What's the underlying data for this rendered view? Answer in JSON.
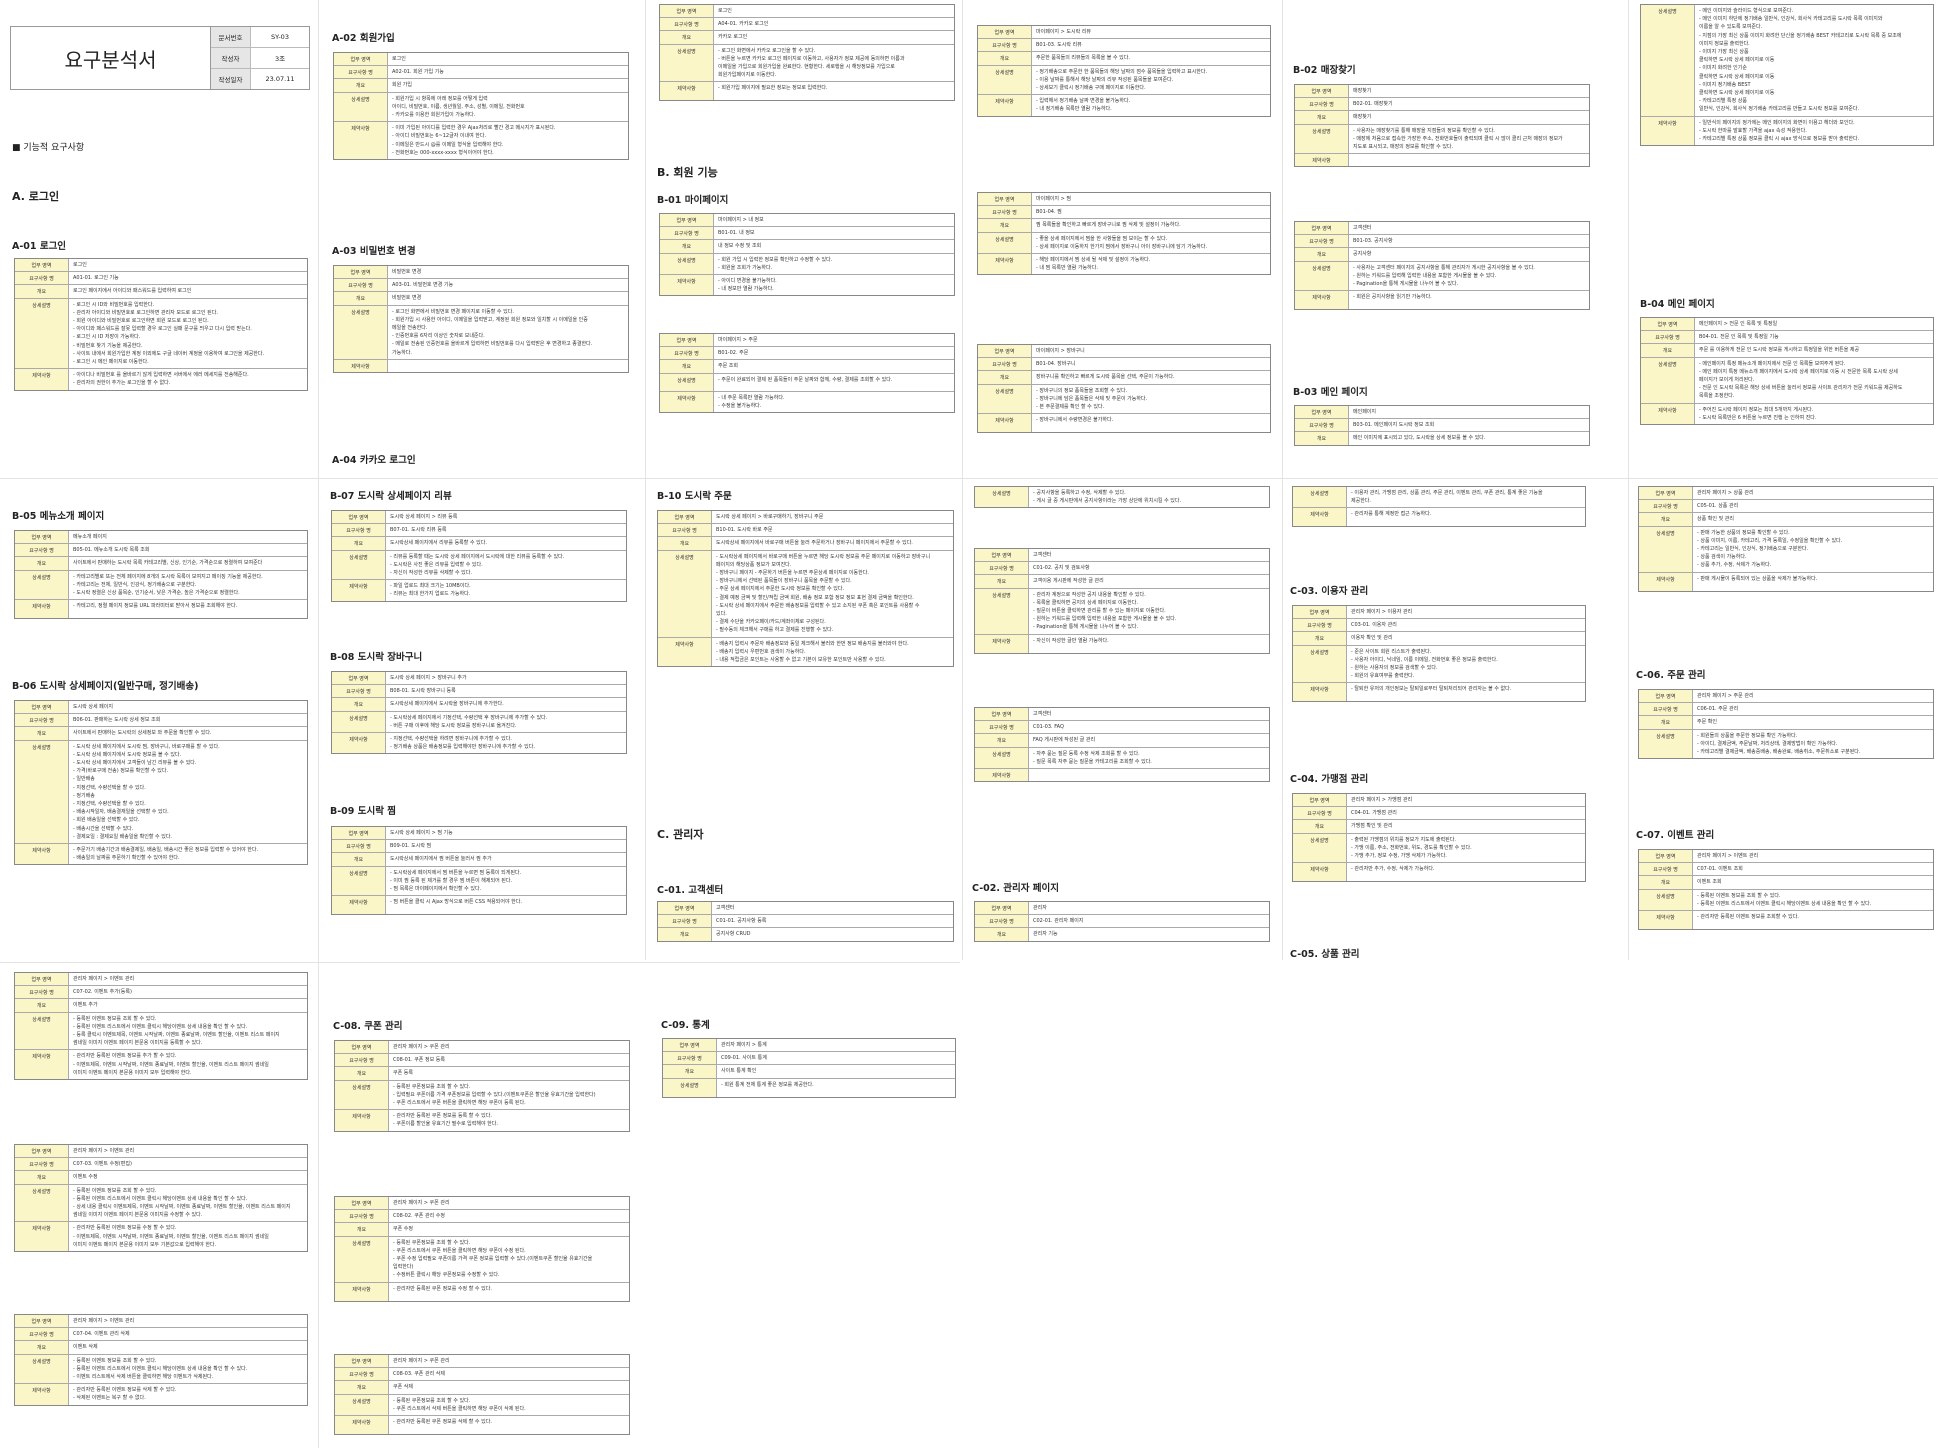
{
  "doc": {
    "title": "요구분석서",
    "meta": [
      {
        "k": "문서번호",
        "v": "SY-03"
      },
      {
        "k": "작성자",
        "v": "3조"
      },
      {
        "k": "작성일자",
        "v": "23.07.11"
      }
    ],
    "section_heading": "■ 기능적 요구사항"
  },
  "labels": {
    "area": "업무 영역",
    "req": "요구사항 명",
    "overview": "개요",
    "detail": "상세설명",
    "constraint": "제약사항"
  },
  "headings": {
    "a": "A. 로그인",
    "a01": "A-01 로그인",
    "a02": "A-02 회원가입",
    "a03": "A-03 비밀번호 변경",
    "a04": "A-04 카카오 로그인",
    "b": "B. 회원 기능",
    "b01": "B-01 마이페이지",
    "b02": "B-02 매장찾기",
    "b03": "B-03 메인 페이지",
    "b04": "B-04 메인 페이지",
    "b05": "B-05 메뉴소개 페이지",
    "b06": "B-06 도시락 상세페이지(일반구매, 정기배송)",
    "b07": "B-07 도시락 상세페이지 리뷰",
    "b08": "B-08 도시락 장바구니",
    "b09": "B-09 도시락 찜",
    "b10": "B-10 도시락 주문",
    "c": "C. 관리자",
    "c01": "C-01. 고객센터",
    "c02": "C-02. 관리자 페이지",
    "c03": "C-03. 이용자 관리",
    "c04": "C-04. 가맹점 관리",
    "c05": "C-05. 상품 관리",
    "c06": "C-06. 주문 관리",
    "c07": "C-07. 이벤트 관리",
    "c08": "C-08. 쿠폰 관리",
    "c09": "C-09. 통계"
  },
  "tables": {
    "a01": {
      "area": "로그인",
      "req": "A01-01. 로그인 기능",
      "overview": "로그인 페이지에서 아이디와 패스워드를 입력하여 로그인",
      "detail": [
        "- 로그인 시 ID와 비밀번호를 입력한다.",
        "- 관리자 아이디와 비밀번호로 로그인하면 관리자 모드로 로그인 된다.",
        "- 회원 아이디와 비밀번호로 로그인하면 회원 모드로 로그인 된다.",
        "- 아이디와 패스워드를 잘못 입력할 경우 로그인 실패 문구를 띄우고 다시 입력 받는다.",
        "- 로그인 시 ID 저장이 가능하다.",
        "- 비밀번호 찾기 기능을 제공한다.",
        "- 사이트 내에서 회원가입한 계정 이외에도 구글 네이버 계정을 이용하여 로그인을 제공한다.",
        "- 로그인 시 메인 페이지로 이동한다."
      ],
      "constraint": [
        "- 아이디나 비밀번호 를 올바르기 않게 입력하면 서버에서 에러 메세지를 전송해준다.",
        "- 관리자의 권한이 추가는 로그인을 할 수 없다."
      ]
    },
    "a02": {
      "area": "로그인",
      "req": "A02-01. 회원 가입 기능",
      "overview": "회원 가입",
      "detail": [
        "- 회원가입 시 항목에 아래 정보를 어떻게 입력",
        "  아이디, 비밀번호, 이름, 생년월일, 주소, 성별, 이메일, 전화번호",
        "- 카카오를 이용한 회원가입이 가능하다."
      ],
      "constraint": [
        "- 이미 가입된 아이디를 입력한 경우 Ajax처리로 빨간 경고 메시지가 표시된다.",
        "- 아이디 비밀번호는 6~12글자 이내여 한다.",
        "- 이메일은 반드시 @를 이메일 형식을 입력해야 한다.",
        "- 전화번호는 000-xxxx-xxxx 형식이어야 한다."
      ]
    },
    "a03": {
      "area": "비밀번호 변경",
      "req": "A03-01. 비밀번호 변경 기능",
      "overview": "비밀번호 변경",
      "detail": [
        "- 로그인 화면에서 비밀번호 변경 페이지로 이동할 수 있다.",
        "- 회원가입 시 사용한 아이디, 이메일을 입력받고, 계정된 회원 정보와 일치할 시 이메일을 인증",
        "  메일을 전송한다.",
        "- 인증번호를 6자리 이상인 숫자로 보내준다.",
        "- 메일로 전송된 인증번호를 올바르게 입력하면 비밀번호를 다시 입력받은 후 변경하고 종결한다.",
        "  가능하다."
      ],
      "constraint": []
    },
    "a04": {
      "area": "로그인",
      "req": "A04-01. 카카오 로그인",
      "overview": "카카오 로그인",
      "detail": [
        "- 로그인 화면에서 카카오 로그인을 할 수 있다.",
        "- 버튼을 누르면 카카오 로그인 페이지로 이동하고, 사용자가 정보 제공에 동의하면 이름과",
        "  이메일을 가입으로 회원가입을 완료한다. 현황한다. 세로행을 시 해당정보를 가입으로",
        "  회원가입페이지로 이동한다."
      ],
      "constraint": [
        "- 회원가입 페이지에 필요한 정보는 정보로 입력한다."
      ]
    },
    "b01a": {
      "area": "마이페이지 > 내 정보",
      "req": "B01-01. 내 정보",
      "overview": "내 정보 수정 및 조회",
      "detail": [
        "- 회원 가입 시 입력한 정보를 확인하고 수정할 수 있다.",
        "- 회원을 조회가 가능하다."
      ],
      "constraint": [
        "- 아이디 변경을 불가능하다.",
        "- 내 정보만 열람 가능하다."
      ]
    },
    "b01b": {
      "area": "마이페이지 > 주문",
      "req": "B01-02. 주문",
      "overview": "주문 조회",
      "detail": [
        "- 주문이 완료되어 결제 된 품목들이 주문 날짜와 함께, 수량, 결제를 조회할 수 있다."
      ],
      "constraint": [
        "- 내 주문 목록만 열람 가능하다.",
        "- 수정을 불가능하다."
      ]
    },
    "b01c": {
      "area": "마이페이지 > 도시락 리뷰",
      "req": "B01-03. 도시락 리뷰",
      "overview": "주문한 품목들의 리뷰들의 목록을 볼 수 있다.",
      "detail": [
        "- 정기배송으로 주문한 한 품목들의 해당 날짜의 점수 품목들을 입력하고 표시한다.",
        "- 이용 날짜를 통해서 해당 날짜의 리뷰 작성된 품목들을 보여준다.",
        "- 상세보기 클릭시 정기배송 구매 페이지로 이동한다."
      ],
      "constraint": [
        "- 입력해서 정기배송 날짜 변경을 불가능하다.",
        "- 내 정기배송 목록만 열람 가능하다."
      ]
    },
    "b01d": {
      "area": "마이페이지 > 찜",
      "req": "B01-04. 찜",
      "overview": "찜 목록들을 확인하고 빠르게 장바구니로 찜 삭제 및 설정이 가능하다.",
      "detail": [
        "- 좋을 상세 페이지에서 찜을 한 사항들을 찜 보이는 할 수 있다.",
        "- 상세 페이지로 이동하지 한가지 찜에서 장바구니 아이 장바구니에 담기 가능하다."
      ],
      "constraint": [
        "- 해당 페이지에서 찜 상세 될 삭제 및 설정이 가능하다.",
        "- 내 찜 목록만 열람 가능하다."
      ]
    },
    "b01e": {
      "area": "마이페이지 > 장바구니",
      "req": "B01-04. 장바구니",
      "overview": "장바구니를 확인하고 빠르게 도시락 품목을 선택, 주문이 가능하다.",
      "detail": [
        "- 장바구니의 정보 품목들을 조회할 수 있다.",
        "- 장바구니에 담은 품목들은 삭제 및 주문이 가능하다.",
        "- 본 주문결제를 확인 할 수 있다."
      ],
      "constraint": [
        "- 장바구니에서 수량변경은 불가하다."
      ]
    },
    "b02a": {
      "area": "매장찾기",
      "req": "B02-01. 매장찾기",
      "overview": "매장찾기",
      "detail": [
        "- 사용자는 매장찾기를 통해 매장을 지점들의 정보를 확인할 수 있다.",
        "- 매장에 처음으로 접속한 가장한 주소, 전화번호들이 출력되며 클릭 시 많이 클리 근처 매장의 정보가",
        "  지도로 표시되고, 매장의 정보를 확인할 수 있다."
      ],
      "constraint": []
    },
    "b02b": {
      "area": "고객센터",
      "req": "B01-03. 공지사항",
      "overview": "공지사항",
      "detail": [
        "- 사용자는 고객센터 페이지의 공지사항을 통해 관리자가 게시한 공지사항을 볼 수 있다.",
        "- 원하는 키워드를 입력해 입력한 내용을 포함한 게시물을 볼 수 있다.",
        "- Pagination을 통해 게시물을 나누어 볼 수 있다."
      ],
      "constraint": [
        "- 회원은 공지사항을 읽기만 가능하다."
      ]
    },
    "b03": {
      "area": "메인페이지",
      "req": "B03-01. 메인페이지 도시락 정보 조회",
      "overview": "메인 이미지에 표시되고 있다, 도시락을 상세 정보를 볼 수 있다."
    },
    "b04": {
      "area": "메인페이지 > 전문 인 목록 및 특정일",
      "req": "B04-01. 전문 인 목록 및 특정일 기능",
      "overview": "주문 를 이용하게 전문 인 도시락 정보를 게시하고 특정일을 위한 버튼을 제공",
      "detail": [
        "- 메인페이지 특정 메뉴소개 페이지에서 전문 인 목록들 보여주게 된다.",
        "- 메인 페이지 특정 메뉴소개 페이지에서 도시락 상세 페이지로 이동 시 전문한 목록 도시락 상세",
        "  페이지가 보이게 처리된다.",
        "- 전문 인 도시락 목록은 해당 상세 버튼을 눌러서 정보를 사이트 관리자가 전문 키워드를 제공하도",
        "  목록을 조정한다."
      ],
      "constraint": [
        "- 주어진 도시락 페이지 정보는 최대 5개까지 게시된다.",
        "- 도시락 목록만은 6 버튼을 누르면 진행 는 인하여 진다."
      ]
    },
    "b04top": {
      "detail": [
        "- 메인 이미지와 슬라이드 형식으로 보여준다.",
        "- 메인 이미지 하단에 정기배송 일반식, 인강식, 회사식 카테고리를 도시락 목록 이미지와",
        "  이름을 알 수 있도록 보여준다.",
        "- 지점의 가장 최신 상품 이미지 화려한 단신을 정기배송 BEST 카테고리로 도시락 목록 중 보조에",
        "  이미지 정보를 출력한다.",
        "- 이미지 가장 최신 상품",
        "  클릭하면 도시락 상세 페이지로 이동",
        "- 이미지 화려한 인기순",
        "  클릭하면 도시락 상세 페이지로 이동",
        "- 이미지 정기배송 BEST",
        "  클릭하면 도시락 상세 페이지로 이동",
        "- 카테고리별 특정 상품",
        "  일반식, 인강식, 회사식 정기배송 카테고리를 만들고 도시락 정보를 보여준다."
      ],
      "constraint": [
        "- 일반식의 페이지의 정가에는 메인 페이지의 화면이 이용고 헤더와 보인다.",
        "- 도시락 한마를 발효할 가격을 ajax 속성 적용한다.",
        "- 카테고리별 특정 상품 정보를 클릭 시 ajax 방식으로 정보를 받아 출력한다."
      ]
    },
    "b05": {
      "area": "메뉴소개 페이지",
      "req": "B05-01. 메뉴소개 도시락 목록 조회",
      "overview": "사이트에서 판매하는 도시락 목록 카테고리별, 신상, 인기순, 가격순으로 정렬하여 보여준다",
      "detail": [
        "- 카테고리별로 또는 전체 페이지에 8개의 도시락 목록이 보여지고 페이징 기능을 제공한다.",
        "- 카테고리는 전체, 일반식, 인강식, 정기배송으로 구분한다.",
        "- 도시락 정렬은 신상 품목순, 인기순서, 낮은 가격순, 높은 가격순으로 정렬한다."
      ],
      "constraint": [
        "- 카테고리, 정렬 페이지 정보를 URL 파라미터로 받아서 정보를 조회해야 한다."
      ]
    },
    "b06": {
      "area": "도시락 상세 페이지",
      "req": "B06-01. 판매하는 도시락 상세 정보 조회",
      "overview": "사이트에서 판매하는 도시락의 상세정보 와 주문을 확인할 수 있다.",
      "detail": [
        "- 도시락 상세 페이지에서 도시락 찜, 장바구니, 바로구매를 할 수 있다.",
        "- 도시락 상세 페이지에서 도시락 정보를 볼 수 있다.",
        "- 도시락 상세 페이지에서 고객들이 남긴 리뷰를 볼 수 있다.",
        "- 가격(바로구매 전송) 정보를 확인할 수 있다.",
        "- 일반배송",
        "  - 지정선택, 수량선택을 할 수 있다.",
        "- 정기배송",
        "  - 지정선택, 수량선택을 할 수 있다.",
        "  - 배송시작일자, 배송결재일을 선택할 수 있다.",
        "  - 회원 배송일을 선택할 수 있다.",
        "  - 배송시간을 선택할 수 있다.",
        "  - 결제요일 : 결제요일 배송일을 확인할 수 있다."
      ],
      "constraint": [
        "- 주문가기 배송기간과 배송결제일, 배송일, 배송시간 좋은 정보를 입력할 수 있어야 한다.",
        "- 배송일의 날짜를 주문하기 확인할 수 있어야 한다."
      ]
    },
    "b07": {
      "area": "도시락 상세 페이지 > 리뷰 등록",
      "req": "B07-01. 도시락 리뷰 등록",
      "overview": "도시락상세 페이지에서 리뷰를 등록할 수 있다.",
      "detail": [
        "- 리뷰를 등록할 때는 도시락 상세 페이지에서 도시락에 대한 리뷰를 등록할 수 있다.",
        "- 도시락은 사진 좋은 리뷰를 입력할 수 있다.",
        "- 자신이 작성한 리뷰를 삭제할 수 있다."
      ],
      "constraint": [
        "- 파일 업로드 최대 크기는 10MB이다.",
        "- 리뷰는 최대 한가지 업로드 가능하다."
      ]
    },
    "b08": {
      "area": "도시락 상세 페이지 > 장바구니 추가",
      "req": "B08-01. 도시락 장바구니 등록",
      "overview": "도시락상세 페이지에서 도시락을 장바구니에 추가한다.",
      "detail": [
        "- 도시락상세 페이지에서 기정선택, 수량선택 후 장바구니에 추가할 수 있다.",
        "- 버튼 구매 이후에 해당 도시락 정보를 장바구니로 옮겨진다."
      ],
      "constraint": [
        "- 지정선택, 수량선택을 하려면 장바구니에 추가할 수 있다.",
        "- 정기배송 상품은 배송정보를 입력해야만 장바구니에 추가할 수 있다."
      ]
    },
    "b09": {
      "area": "도시락 상세 페이지 > 찜 기능",
      "req": "B09-01. 도시락 찜",
      "overview": "도시락상세 페이지에서 찜 버튼을 눌러서 찜 추가",
      "detail": [
        "- 도시락상세 페이지에서 찜 버튼을 누르면 찜 등록이 되게된다.",
        "- 이미 찜 등록 된 제거를 할 경우 찜 버튼이 해제되어 된다.",
        "- 찜 목록은 마이페이지에서 확인할 수 있다."
      ],
      "constraint": [
        "- 찜 버튼을 클릭 시 Ajax 방식으로 버튼 CSS 적용되어야 한다."
      ]
    },
    "b10": {
      "area": "도시락 상세 페이지 > 바로구매하기, 장바구니 주문",
      "req": "B10-01. 도시락 바로 주문",
      "overview": "도시락상세 페이지에서 바로구매 버튼을 눌러 주문하거나 장바구니 페이지에서 주문할 수 있다.",
      "detail": [
        "- 도시락상세 페이지에서 바로구매 버튼을 누르면 해당 도시락 정보를 주문 페이지로 이동하고 장바구니",
        "  페이지의 해당상품 정보가 보여진다.",
        "- 장바구니 페이지 - 주문하기 버튼을 누르면 주문상세 페이지로 이동한다.",
        "- 장바구니에서 선택된 품목들이 장바구니 품목을 주문할 수 있다.",
        "- 주문 상세 페이지에서 주문한 도시락 정보를 확인할 수 있다.",
        "- 결제 예정 금액 및 할인/적립 금액 회원, 배송 정보 포함 정보 정보 표현 결제 금액을 확인한다.",
        "- 도시락 상세 페이지에서 주문한 배송정보를 입력할 수 있고 소지된 쿠폰 혹은 포인트를 사용할 수",
        "  있다.",
        "- 결제 수단을 카카오페이/카드/계좌이체로 구성된다.",
        "- 필수동의 체크해서 구매를 하고 결제를 진행할 수 있다."
      ],
      "constraint": [
        "- 배송지 입력시 주문자 배송정보와 동일 체크해서 불러와 한번 정보 배송지를 불러와야 한다.",
        "- 배송지 입력시 우편번호 검색이 가능하다.",
        "- 내용 적립금은 포인트는 사용할 수 없고 기본이 보유한 포인트만 사용할 수 있다."
      ]
    },
    "b10more": {
      "detail": [
        "- 공지사항을 등록하고 수정, 삭제할 수 있다.",
        "- 게시 글 중 게시판에서 공지사항이라는 가장 상단에 위치시킬 수 있다."
      ]
    },
    "c01x": {
      "area": "고객센터",
      "req": "C01-02. 공지 및 검토사항",
      "overview": "고객이용 게시판에 작성한 글 관리",
      "detail": [
        "- 관리자 계정으로 작성한 공지 내용을 확인할 수 있다.",
        "- 목록을 클릭하면 공지의 상세 페이지로 이동한다.",
        "- 질문이 버튼을 클릭하면 관리를 할 수 있는 페이지로 이동한다.",
        "- 원하는 키워드를 입력해 입력한 내용을 포함한 게시물을 볼 수 있다.",
        "- Pagination을 통해 게시물을 나누어 볼 수 있다."
      ],
      "constraint": [
        "- 자신이 작성한 글만 열람 가능하다."
      ]
    },
    "c01y": {
      "area": "고객센터",
      "req": "C01-03. FAQ",
      "overview": "FAQ 게시판에 작성된 글 관리",
      "detail": [
        "- 자주 묻는 질문 등록 수정 삭제 조회를 할 수 있다.",
        "- 질문 목록 자주 묻는 질문을 카테고리를 조회할 수 있다."
      ],
      "constraint": []
    },
    "c01": {
      "area": "고객센터",
      "req": "C01-01. 공지사항 등록",
      "overview": "공지사항 CRUD"
    },
    "c02": {
      "area": "관리자",
      "req": "C02-01. 관리자 페이지",
      "overview": "관리자 기능"
    },
    "c02top": {
      "detail": [
        "- 이용자 관리, 가맹점 관리, 상품 관리, 주문 관리, 이벤트 관리, 쿠폰 관리, 통계 좋은 기능을",
        "  제공한다."
      ],
      "constraint": [
        "- 관리자를 통해 계정만 접근 가능하다."
      ]
    },
    "c03": {
      "area": "관리자 페이지 > 이용자 관리",
      "req": "C03-01. 이용자 관리",
      "overview": "이용자 확인 및 관리",
      "detail": [
        "- 준은 사이트 회원 리스트가 출력된다.",
        "- 사용자 아이디, 닉네임, 이름 이메일, 전화번호 좋은 정보를 출력한다.",
        "- 원하는 사용자의 정보를 검색할 수 있다.",
        "- 회원의 유효여부를 출력한다."
      ],
      "constraint": [
        "- 탈퇴한 유저의 개인정보는 탈퇴일로부터 탈퇴처리되어 관리자는 볼 수 없다."
      ]
    },
    "c04": {
      "area": "관리자 페이지 > 가맹점 관리",
      "req": "C04-01. 가맹점 관리",
      "overview": "가맹점 확인 및 관리",
      "detail": [
        "- 출력된 가맹점의 위치를 정보가 지도에 출력된다.",
        "- 가맹 이름, 주소, 전화번호, 위도, 경도를 확인할 수 있다.",
        "- 가맹 추가, 정보 수정, 가맹 삭제가 가능하다."
      ],
      "constraint": [
        "- 관리자만 추가, 수정, 삭제가 가능하다."
      ]
    },
    "c05": {
      "area": "관리자 페이지 > 상품 관리",
      "req": "C05-01. 상품 관리",
      "overview": "상품 확인 및 관리",
      "detail": [
        "- 판매 가능한 상품의 정보를 확인할 수 있다.",
        "- 상품 이미지, 이름, 카테고리, 가격 등록일, 수정일을 확인할 수 있다.",
        "- 카테고리는 일반식, 인강식, 정기배송으로 구분한다.",
        "- 상품 검색이 가능하다.",
        "- 상품 추가, 수정, 삭제가 가능하다."
      ],
      "constraint": [
        "- 판매 게시물이 등록되어 있는 상품을 삭제가 불가능하다."
      ]
    },
    "c06": {
      "area": "관리자 페이지 > 주문 관리",
      "req": "C06-01. 주문 관리",
      "overview": "주문 확인",
      "detail": [
        "- 회원들의 상품을 주문한 정보를 확인 가능하다.",
        "- 아이디, 결제금액, 주문날짜, 처리상태, 결제방법이 확인 가능하다.",
        "- 카테고리별 결제금액, 배송중배송, 배송완료, 배송취소, 주문취소로 구분된다."
      ],
      "constraint": []
    },
    "c07a": {
      "area": "관리자 페이지 > 이벤트 관리",
      "req": "C07-01. 이벤트 조회",
      "overview": "이벤트 조회",
      "detail": [
        "- 등록된 이벤트 정보를 조회 할 수 있다.",
        "- 등록된 이벤트 리스트에서 이벤트 클릭시 해당이벤트 상세 내용을 확인 할 수 있다."
      ],
      "constraint": [
        "- 관리자만 등록된 이벤트 정보를 조회할 수 있다."
      ]
    },
    "c07b": {
      "area": "관리자 페이지 > 이벤트 관리",
      "req": "C07-02. 이벤트 추가(등록)",
      "overview": "이벤트 추가",
      "detail": [
        "- 등록된 이벤트 정보를 조회 할 수 있다.",
        "- 등록된 이벤트 리스트에서 이벤트 클릭시 해당이벤트 상세 내용을 확인 할 수 있다.",
        "- 등록 클릭시 이벤트제목, 이벤트 시작날짜, 이벤트 종료날짜, 이벤트 할인율, 이벤트 리스트 페이지",
        "  썸네일 이미지 이벤트 페이지 본문용 이미지를 등록할 수 있다."
      ],
      "constraint": [
        "- 관리자만 등록된 이벤트 정보를 추가 할 수 있다.",
        "- 이벤트제목, 이벤트 시작날짜, 이벤트 종료날짜, 이벤트 할인율, 이벤트 리스트 페이지 썸네일",
        "  이미지 이벤트 페이지 본문용 이미지 모두 입력해야 한다."
      ]
    },
    "c07c": {
      "area": "관리자 페이지 > 이벤트 관리",
      "req": "C07-03. 이벤트 수정(편집)",
      "overview": "이벤트 수정",
      "detail": [
        "- 등록된 이벤트 정보를 조회 할 수 있다.",
        "- 등록된 이벤트 리스트에서 이벤트 클릭시 해당이벤트 상세 내용을 확인 할 수 있다.",
        "- 상세 내용 클릭시 이벤트제목, 이벤트 시작날짜, 이벤트 종료날짜, 이벤트 할인율, 이벤트 리스트 페이지",
        "  썸네일 이미지 이벤트 페이지 본문용 이미지를 수정할 수 있다."
      ],
      "constraint": [
        "- 관리자만 등록된 이벤트 정보를 수정 할 수 있다.",
        "- 이벤트제목, 이벤트 시작날짜, 이벤트 종료날짜, 이벤트 할인율, 이벤트 리스트 페이지 썸네일",
        "  이미지 이벤트 페이지 본문용 이미지 모두 기본값으로 입력해야 한다."
      ]
    },
    "c07d": {
      "area": "관리자 페이지 > 이벤트 관리",
      "req": "C07-04. 이벤트 관리 삭제",
      "overview": "이벤트 삭제",
      "detail": [
        "- 등록된 이벤트 정보를 조회 할 수 있다.",
        "- 등록된 이벤트 리스트에서 이벤트 클릭시 해당이벤트 상세 내용을 확인 할 수 있다.",
        "- 이벤트 리스트에서 삭제 버튼을 클릭하면 해당 이벤트가 삭제된다."
      ],
      "constraint": [
        "- 관리자만 등록된 이벤트 정보를 삭제 할 수 있다.",
        "- 삭제된 이벤트는 복구 할 수 없다."
      ]
    },
    "c08a": {
      "area": "관리자 페이지 > 쿠폰 관리",
      "req": "C08-01. 쿠폰 정보 등록",
      "overview": "쿠폰 등록",
      "detail": [
        "- 등록된 쿠폰정보를 조회 할 수 있다.",
        "- 입력필요 쿠폰이름 가격 쿠폰정보를 입력할 수 있다.(이벤트쿠폰은 할인율 유효기간을 입력한다)",
        "- 쿠폰 리스트에서 쿠폰 버튼을 클릭하면 해당 쿠폰이 등록 된다."
      ],
      "constraint": [
        "- 관리자만 등록된 쿠폰 정보를 등록 할 수 있다.",
        "- 쿠폰이름 할인율 유효기간 필수로 입력해야 한다."
      ]
    },
    "c08b": {
      "area": "관리자 페이지 > 쿠폰 관리",
      "req": "C08-02. 쿠폰 관리 수정",
      "overview": "쿠폰 수정",
      "detail": [
        "- 등록된 쿠폰정보를 조회 할 수 있다.",
        "- 쿠폰 리스트에서 쿠폰 버튼을 클릭하면 해당 쿠폰이 수정 된다.",
        "- 쿠폰 수정 입력필요 쿠폰이름 가격 쿠폰 정보를 입력할 수 있다.(이벤트쿠폰 할인율 유효기간을",
        "  입력한다)",
        "- 수정버튼 클릭시 해당 쿠폰정보를 수정할 수 있다."
      ],
      "constraint": [
        "- 관리자만 등록된 쿠폰 정보를 수정 할 수 있다."
      ]
    },
    "c08c": {
      "area": "관리자 페이지 > 쿠폰 관리",
      "req": "C08-03. 쿠폰 관리 삭제",
      "overview": "쿠폰 삭제",
      "detail": [
        "- 등록된 쿠폰정보를 조회 할 수 있다.",
        "- 쿠폰 리스트에서 삭제 버튼을 클릭하면 해당 쿠폰이 삭제 된다."
      ],
      "constraint": [
        "- 관리자만 등록된 쿠폰 정보를 삭제 할 수 있다."
      ]
    },
    "c09": {
      "area": "관리자 페이지 > 통계",
      "req": "C09-01. 사이트 통계",
      "overview": "사이트 통계 확인",
      "detail": [
        "- 회원 통계 전체 통계 좋은 정보를 제공한다."
      ],
      "constraint": []
    }
  }
}
